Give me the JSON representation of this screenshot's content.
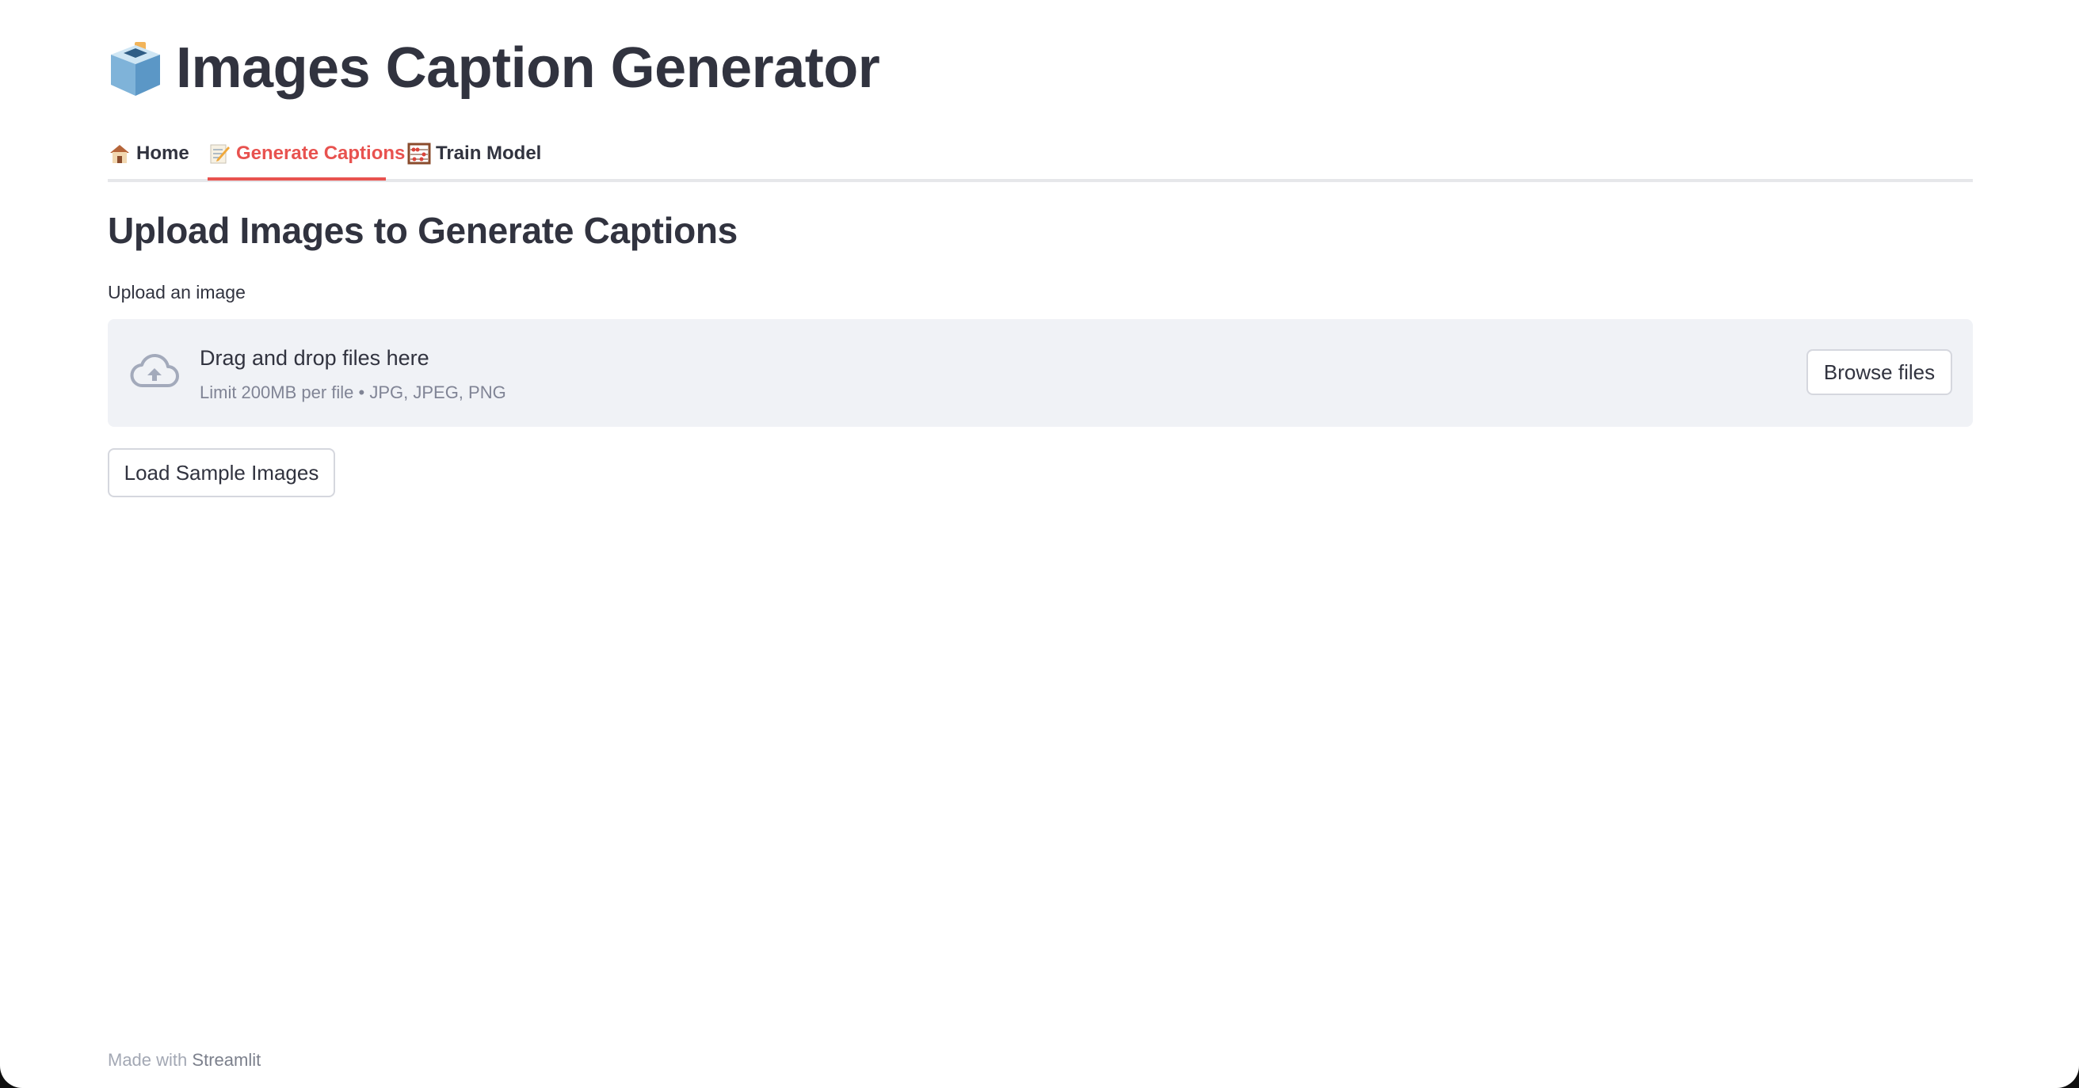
{
  "header": {
    "title": "Images Caption Generator",
    "title_icon": "ballot-box-icon"
  },
  "tabs": [
    {
      "label": "Home",
      "icon": "house-icon",
      "active": false
    },
    {
      "label": "Generate Captions",
      "icon": "memo-icon",
      "active": true
    },
    {
      "label": "Train Model",
      "icon": "abacus-icon",
      "active": false
    }
  ],
  "main": {
    "heading": "Upload Images to Generate Captions",
    "upload_label": "Upload an image",
    "dropzone": {
      "title": "Drag and drop files here",
      "subtitle": "Limit 200MB per file • JPG, JPEG, PNG",
      "icon": "cloud-upload-icon",
      "browse_label": "Browse files"
    },
    "sample_button_label": "Load Sample Images"
  },
  "footer": {
    "prefix": "Made with",
    "brand": "Streamlit"
  },
  "colors": {
    "accent": "#e8524f",
    "text": "#31333f",
    "dropzone_bg": "#f0f2f6",
    "muted": "#808495"
  }
}
